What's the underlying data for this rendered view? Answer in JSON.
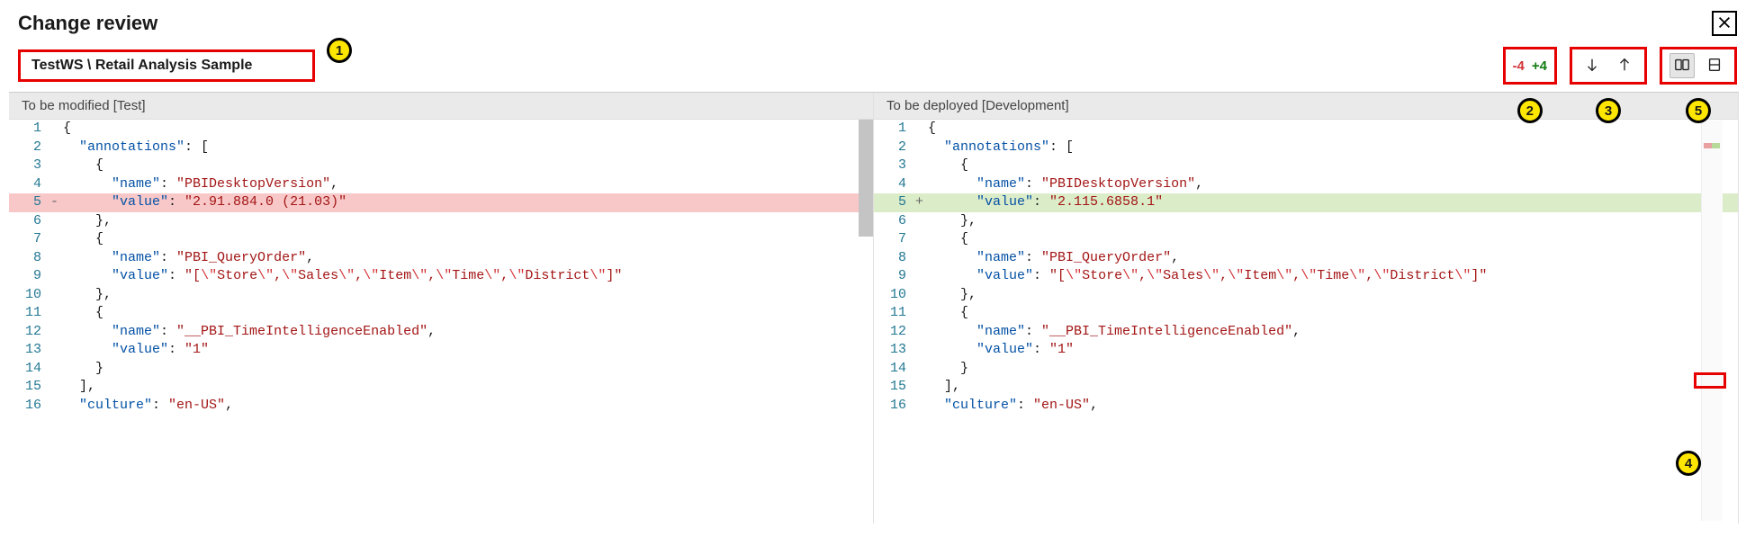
{
  "header": {
    "title": "Change review"
  },
  "breadcrumb": {
    "text": "TestWS \\ Retail Analysis Sample"
  },
  "counts": {
    "removed": "-4",
    "added": "+4"
  },
  "annotations": [
    "1",
    "2",
    "3",
    "4",
    "5"
  ],
  "columns": {
    "left": {
      "title": "To be modified [Test]"
    },
    "right": {
      "title": "To be deployed [Development]"
    }
  },
  "code": {
    "left": [
      {
        "n": "1",
        "m": "",
        "t": [
          [
            "punc",
            "{"
          ]
        ]
      },
      {
        "n": "2",
        "m": "",
        "t": [
          [
            "punc",
            "  "
          ],
          [
            "key",
            "\"annotations\""
          ],
          [
            "punc",
            ": ["
          ]
        ]
      },
      {
        "n": "3",
        "m": "",
        "t": [
          [
            "punc",
            "    {"
          ]
        ]
      },
      {
        "n": "4",
        "m": "",
        "t": [
          [
            "punc",
            "      "
          ],
          [
            "key",
            "\"name\""
          ],
          [
            "punc",
            ": "
          ],
          [
            "str",
            "\"PBIDesktopVersion\""
          ],
          [
            "punc",
            ","
          ]
        ]
      },
      {
        "n": "5",
        "m": "-",
        "cls": "del",
        "t": [
          [
            "punc",
            "      "
          ],
          [
            "key",
            "\"value\""
          ],
          [
            "punc",
            ": "
          ],
          [
            "str",
            "\"2.91.884.0 (21.03)\""
          ]
        ]
      },
      {
        "n": "6",
        "m": "",
        "t": [
          [
            "punc",
            "    },"
          ]
        ]
      },
      {
        "n": "7",
        "m": "",
        "t": [
          [
            "punc",
            "    {"
          ]
        ]
      },
      {
        "n": "8",
        "m": "",
        "t": [
          [
            "punc",
            "      "
          ],
          [
            "key",
            "\"name\""
          ],
          [
            "punc",
            ": "
          ],
          [
            "str",
            "\"PBI_QueryOrder\""
          ],
          [
            "punc",
            ","
          ]
        ]
      },
      {
        "n": "9",
        "m": "",
        "t": [
          [
            "punc",
            "      "
          ],
          [
            "key",
            "\"value\""
          ],
          [
            "punc",
            ": "
          ],
          [
            "str",
            "\"["
          ],
          [
            "esc",
            "\\\""
          ],
          [
            "str",
            "Store"
          ],
          [
            "esc",
            "\\\""
          ],
          [
            "str",
            ","
          ],
          [
            "esc",
            "\\\""
          ],
          [
            "str",
            "Sales"
          ],
          [
            "esc",
            "\\\""
          ],
          [
            "str",
            ","
          ],
          [
            "esc",
            "\\\""
          ],
          [
            "str",
            "Item"
          ],
          [
            "esc",
            "\\\""
          ],
          [
            "str",
            ","
          ],
          [
            "esc",
            "\\\""
          ],
          [
            "str",
            "Time"
          ],
          [
            "esc",
            "\\\""
          ],
          [
            "str",
            ","
          ],
          [
            "esc",
            "\\\""
          ],
          [
            "str",
            "District"
          ],
          [
            "esc",
            "\\\""
          ],
          [
            "str",
            "]\""
          ]
        ]
      },
      {
        "n": "10",
        "m": "",
        "t": [
          [
            "punc",
            "    },"
          ]
        ]
      },
      {
        "n": "11",
        "m": "",
        "t": [
          [
            "punc",
            "    {"
          ]
        ]
      },
      {
        "n": "12",
        "m": "",
        "t": [
          [
            "punc",
            "      "
          ],
          [
            "key",
            "\"name\""
          ],
          [
            "punc",
            ": "
          ],
          [
            "str",
            "\"__PBI_TimeIntelligenceEnabled\""
          ],
          [
            "punc",
            ","
          ]
        ]
      },
      {
        "n": "13",
        "m": "",
        "t": [
          [
            "punc",
            "      "
          ],
          [
            "key",
            "\"value\""
          ],
          [
            "punc",
            ": "
          ],
          [
            "str",
            "\"1\""
          ]
        ]
      },
      {
        "n": "14",
        "m": "",
        "t": [
          [
            "punc",
            "    }"
          ]
        ]
      },
      {
        "n": "15",
        "m": "",
        "t": [
          [
            "punc",
            "  ],"
          ]
        ]
      },
      {
        "n": "16",
        "m": "",
        "t": [
          [
            "punc",
            "  "
          ],
          [
            "key",
            "\"culture\""
          ],
          [
            "punc",
            ": "
          ],
          [
            "str",
            "\"en-US\""
          ],
          [
            "punc",
            ","
          ]
        ]
      }
    ],
    "right": [
      {
        "n": "1",
        "m": "",
        "t": [
          [
            "punc",
            "{"
          ]
        ]
      },
      {
        "n": "2",
        "m": "",
        "t": [
          [
            "punc",
            "  "
          ],
          [
            "key",
            "\"annotations\""
          ],
          [
            "punc",
            ": ["
          ]
        ]
      },
      {
        "n": "3",
        "m": "",
        "t": [
          [
            "punc",
            "    {"
          ]
        ]
      },
      {
        "n": "4",
        "m": "",
        "t": [
          [
            "punc",
            "      "
          ],
          [
            "key",
            "\"name\""
          ],
          [
            "punc",
            ": "
          ],
          [
            "str",
            "\"PBIDesktopVersion\""
          ],
          [
            "punc",
            ","
          ]
        ]
      },
      {
        "n": "5",
        "m": "+",
        "cls": "add",
        "t": [
          [
            "punc",
            "      "
          ],
          [
            "key",
            "\"value\""
          ],
          [
            "punc",
            ": "
          ],
          [
            "str",
            "\"2.115.6858.1\""
          ]
        ]
      },
      {
        "n": "6",
        "m": "",
        "t": [
          [
            "punc",
            "    },"
          ]
        ]
      },
      {
        "n": "7",
        "m": "",
        "t": [
          [
            "punc",
            "    {"
          ]
        ]
      },
      {
        "n": "8",
        "m": "",
        "t": [
          [
            "punc",
            "      "
          ],
          [
            "key",
            "\"name\""
          ],
          [
            "punc",
            ": "
          ],
          [
            "str",
            "\"PBI_QueryOrder\""
          ],
          [
            "punc",
            ","
          ]
        ]
      },
      {
        "n": "9",
        "m": "",
        "t": [
          [
            "punc",
            "      "
          ],
          [
            "key",
            "\"value\""
          ],
          [
            "punc",
            ": "
          ],
          [
            "str",
            "\"["
          ],
          [
            "esc",
            "\\\""
          ],
          [
            "str",
            "Store"
          ],
          [
            "esc",
            "\\\""
          ],
          [
            "str",
            ","
          ],
          [
            "esc",
            "\\\""
          ],
          [
            "str",
            "Sales"
          ],
          [
            "esc",
            "\\\""
          ],
          [
            "str",
            ","
          ],
          [
            "esc",
            "\\\""
          ],
          [
            "str",
            "Item"
          ],
          [
            "esc",
            "\\\""
          ],
          [
            "str",
            ","
          ],
          [
            "esc",
            "\\\""
          ],
          [
            "str",
            "Time"
          ],
          [
            "esc",
            "\\\""
          ],
          [
            "str",
            ","
          ],
          [
            "esc",
            "\\\""
          ],
          [
            "str",
            "District"
          ],
          [
            "esc",
            "\\\""
          ],
          [
            "str",
            "]\""
          ]
        ]
      },
      {
        "n": "10",
        "m": "",
        "t": [
          [
            "punc",
            "    },"
          ]
        ]
      },
      {
        "n": "11",
        "m": "",
        "t": [
          [
            "punc",
            "    {"
          ]
        ]
      },
      {
        "n": "12",
        "m": "",
        "t": [
          [
            "punc",
            "      "
          ],
          [
            "key",
            "\"name\""
          ],
          [
            "punc",
            ": "
          ],
          [
            "str",
            "\"__PBI_TimeIntelligenceEnabled\""
          ],
          [
            "punc",
            ","
          ]
        ]
      },
      {
        "n": "13",
        "m": "",
        "t": [
          [
            "punc",
            "      "
          ],
          [
            "key",
            "\"value\""
          ],
          [
            "punc",
            ": "
          ],
          [
            "str",
            "\"1\""
          ]
        ]
      },
      {
        "n": "14",
        "m": "",
        "t": [
          [
            "punc",
            "    }"
          ]
        ]
      },
      {
        "n": "15",
        "m": "",
        "t": [
          [
            "punc",
            "  ],"
          ]
        ]
      },
      {
        "n": "16",
        "m": "",
        "t": [
          [
            "punc",
            "  "
          ],
          [
            "key",
            "\"culture\""
          ],
          [
            "punc",
            ": "
          ],
          [
            "str",
            "\"en-US\""
          ],
          [
            "punc",
            ","
          ]
        ]
      }
    ]
  }
}
